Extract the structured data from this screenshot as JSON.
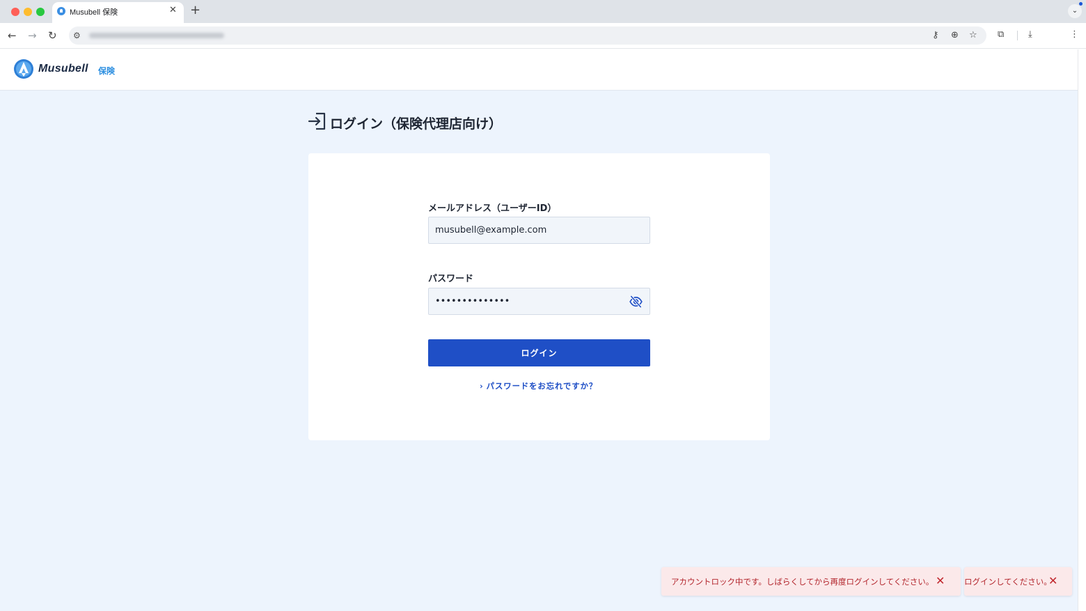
{
  "browser": {
    "tab_title": "Musubell 保険",
    "tab_close": "✕",
    "new_tab": "+",
    "tab_menu": "⌄",
    "back": "←",
    "forward": "→",
    "reload": "↻",
    "site_settings": "⚙",
    "icons": {
      "key": "⚷",
      "zoom": "⊕",
      "bookmark": "☆",
      "extensions": "⧉",
      "download": "⤓",
      "more": "⋮"
    }
  },
  "header": {
    "logo_text": "Musubell",
    "logo_sub": "保険",
    "logo_color": "#2d8fe0"
  },
  "page": {
    "title": "ログイン（保険代理店向け）"
  },
  "form": {
    "email_label": "メールアドレス（ユーザーID）",
    "email_value": "musubell@example.com",
    "password_label": "パスワード",
    "password_value": "••••••••••••••",
    "login_button": "ログイン",
    "forgot_chevron": "›",
    "forgot_link": "パスワードをお忘れですか？"
  },
  "toasts": [
    {
      "message": "アカウントロック中です。しばらくしてから再度ログインしてください。",
      "close": "✕"
    },
    {
      "message": "ログインしてください。",
      "close": "✕"
    }
  ],
  "colors": {
    "primary": "#1f4fc6",
    "page_bg": "#edf4fd",
    "toast_bg": "#fbe9ea",
    "toast_text": "#b3262d"
  }
}
